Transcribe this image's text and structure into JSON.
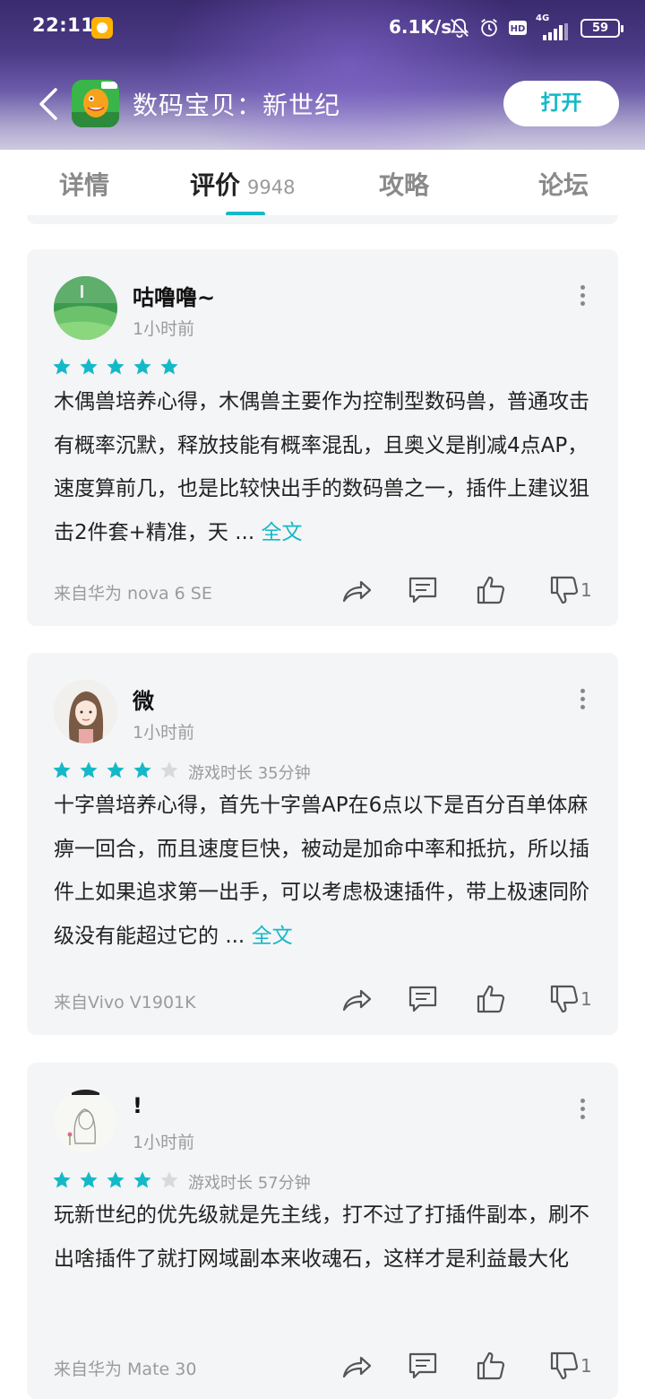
{
  "status_bar": {
    "time": "22:11",
    "network_speed": "6.1K/s",
    "network_type": "4G",
    "battery": "59",
    "hd_label": "HD"
  },
  "header": {
    "app_name": "数码宝贝：新世纪",
    "open_button": "打开"
  },
  "tabs": [
    {
      "label": "详情"
    },
    {
      "label": "评价",
      "count": "9948",
      "active": true
    },
    {
      "label": "攻略"
    },
    {
      "label": "论坛"
    }
  ],
  "reviews": [
    {
      "user": "咕噜噜~",
      "time": "1小时前",
      "rating": 5,
      "playtime": "",
      "text": "木偶兽培养心得，木偶兽主要作为控制型数码兽，普通攻击有概率沉默，释放技能有概率混乱，且奥义是削减4点AP，速度算前几，也是比较快出手的数码兽之一，插件上建议狙击2件套+精准，天",
      "ellipsis": "...",
      "more_label": "全文",
      "device": "来自华为 nova 6 SE",
      "dislike_count": "1"
    },
    {
      "user": "微",
      "time": "1小时前",
      "rating": 4,
      "playtime": "游戏时长 35分钟",
      "text": "十字兽培养心得，首先十字兽AP在6点以下是百分百单体麻痹一回合，而且速度巨快，被动是加命中率和抵抗，所以插件上如果追求第一出手，可以考虑极速插件，带上极速同阶级没有能超过它的",
      "ellipsis": "...",
      "more_label": "全文",
      "device": "来自Vivo V1901K",
      "dislike_count": "1"
    },
    {
      "user": "!",
      "time": "1小时前",
      "rating": 4,
      "playtime": "游戏时长 57分钟",
      "text": "玩新世纪的优先级就是先主线，打不过了打插件副本，刷不出啥插件了就打网域副本来收魂石，这样才是利益最大化",
      "ellipsis": "",
      "more_label": "",
      "device": "来自华为 Mate 30",
      "dislike_count": "1"
    }
  ],
  "colors": {
    "accent": "#14b9c8",
    "card_bg": "#f4f5f7",
    "star_empty": "#d9d9d9",
    "header_gradient_top": "#3a2a6e"
  },
  "icons": [
    "back-arrow-icon",
    "share-icon",
    "comment-icon",
    "like-icon",
    "dislike-icon",
    "more-options-icon",
    "mute-bell-icon",
    "alarm-icon",
    "signal-icon"
  ]
}
